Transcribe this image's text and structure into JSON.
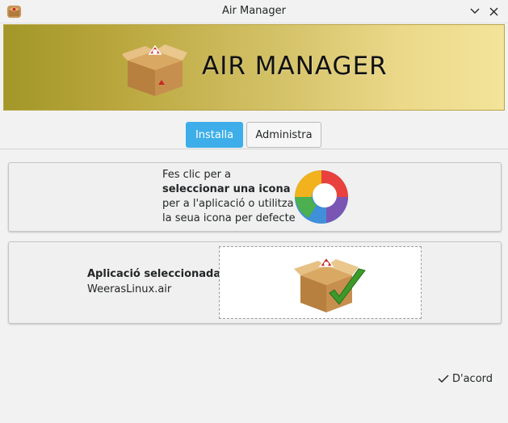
{
  "window": {
    "title": "Air Manager",
    "app_icon": "box-package-icon",
    "minimize_icon": "chevron-down-icon",
    "close_icon": "close-icon"
  },
  "banner": {
    "title": "AIR  MANAGER",
    "logo_icon": "adobe-air-box-icon"
  },
  "tabs": [
    {
      "label": "Installa",
      "active": true
    },
    {
      "label": "Administra",
      "active": false
    }
  ],
  "icon_panel": {
    "text_part1": "Fes clic per a ",
    "text_bold": "seleccionar una icona",
    "text_part2": " per a l'aplicació o utilitza la seua icona per defecte",
    "icon": "default-app-circle-icon"
  },
  "app_panel": {
    "label": "Aplicació seleccionada:",
    "file": "WeerasLinux.air",
    "preview_icon": "air-package-check-icon"
  },
  "footer": {
    "ok_label": "D'acord",
    "ok_icon": "check-icon"
  },
  "colors": {
    "accent": "#3daee9",
    "banner_start": "#a29728",
    "banner_end": "#f3e49a"
  }
}
